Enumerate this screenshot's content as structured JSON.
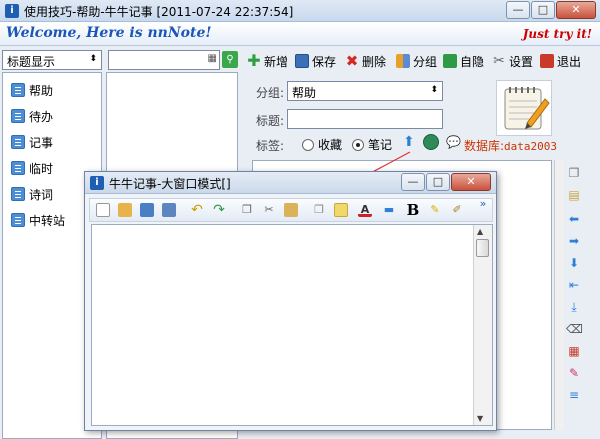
{
  "window": {
    "title": "使用技巧-帮助-牛牛记事 [2011-07-24 22:37:54]",
    "min_label": "—",
    "max_label": "□",
    "close_label": "✕"
  },
  "banner": {
    "welcome": "Welcome, Here is nnNote!",
    "tryit": "Just try it!"
  },
  "left": {
    "mode_select": "标题显示",
    "items": [
      {
        "label": "帮助"
      },
      {
        "label": "待办"
      },
      {
        "label": "记事"
      },
      {
        "label": "临时"
      },
      {
        "label": "诗词"
      },
      {
        "label": "中转站"
      }
    ]
  },
  "toolbar": {
    "items": [
      {
        "label": "新增",
        "icon": "plus-icon",
        "color": "#2f9e3e"
      },
      {
        "label": "保存",
        "icon": "save-icon",
        "color": "#3b6fb6"
      },
      {
        "label": "删除",
        "icon": "delete-icon",
        "color": "#d42a1f"
      },
      {
        "label": "分组",
        "icon": "group-icon",
        "color": "#e7a12a"
      },
      {
        "label": "自隐",
        "icon": "hide-icon",
        "color": "#2e9a45"
      },
      {
        "label": "设置",
        "icon": "settings-icon",
        "color": "#6b6b6b"
      },
      {
        "label": "退出",
        "icon": "exit-icon",
        "color": "#c83a2a"
      }
    ]
  },
  "form": {
    "group_label": "分组:",
    "group_value": "帮助",
    "title_label": "标题:",
    "title_value": "",
    "tag_label": "标签:",
    "tag_options": [
      {
        "label": "收藏",
        "checked": false
      },
      {
        "label": "笔记",
        "checked": true
      }
    ],
    "db_label": "数据库:",
    "db_value": "data2003"
  },
  "popup": {
    "title": "牛牛记事-大窗口模式[]",
    "min_label": "—",
    "max_label": "□",
    "close_label": "✕",
    "more_label": "»"
  },
  "colors": {
    "accent": "#1a55b8",
    "tryit": "#cc0000",
    "db": "#cc3300",
    "arrow": "#e03030"
  }
}
